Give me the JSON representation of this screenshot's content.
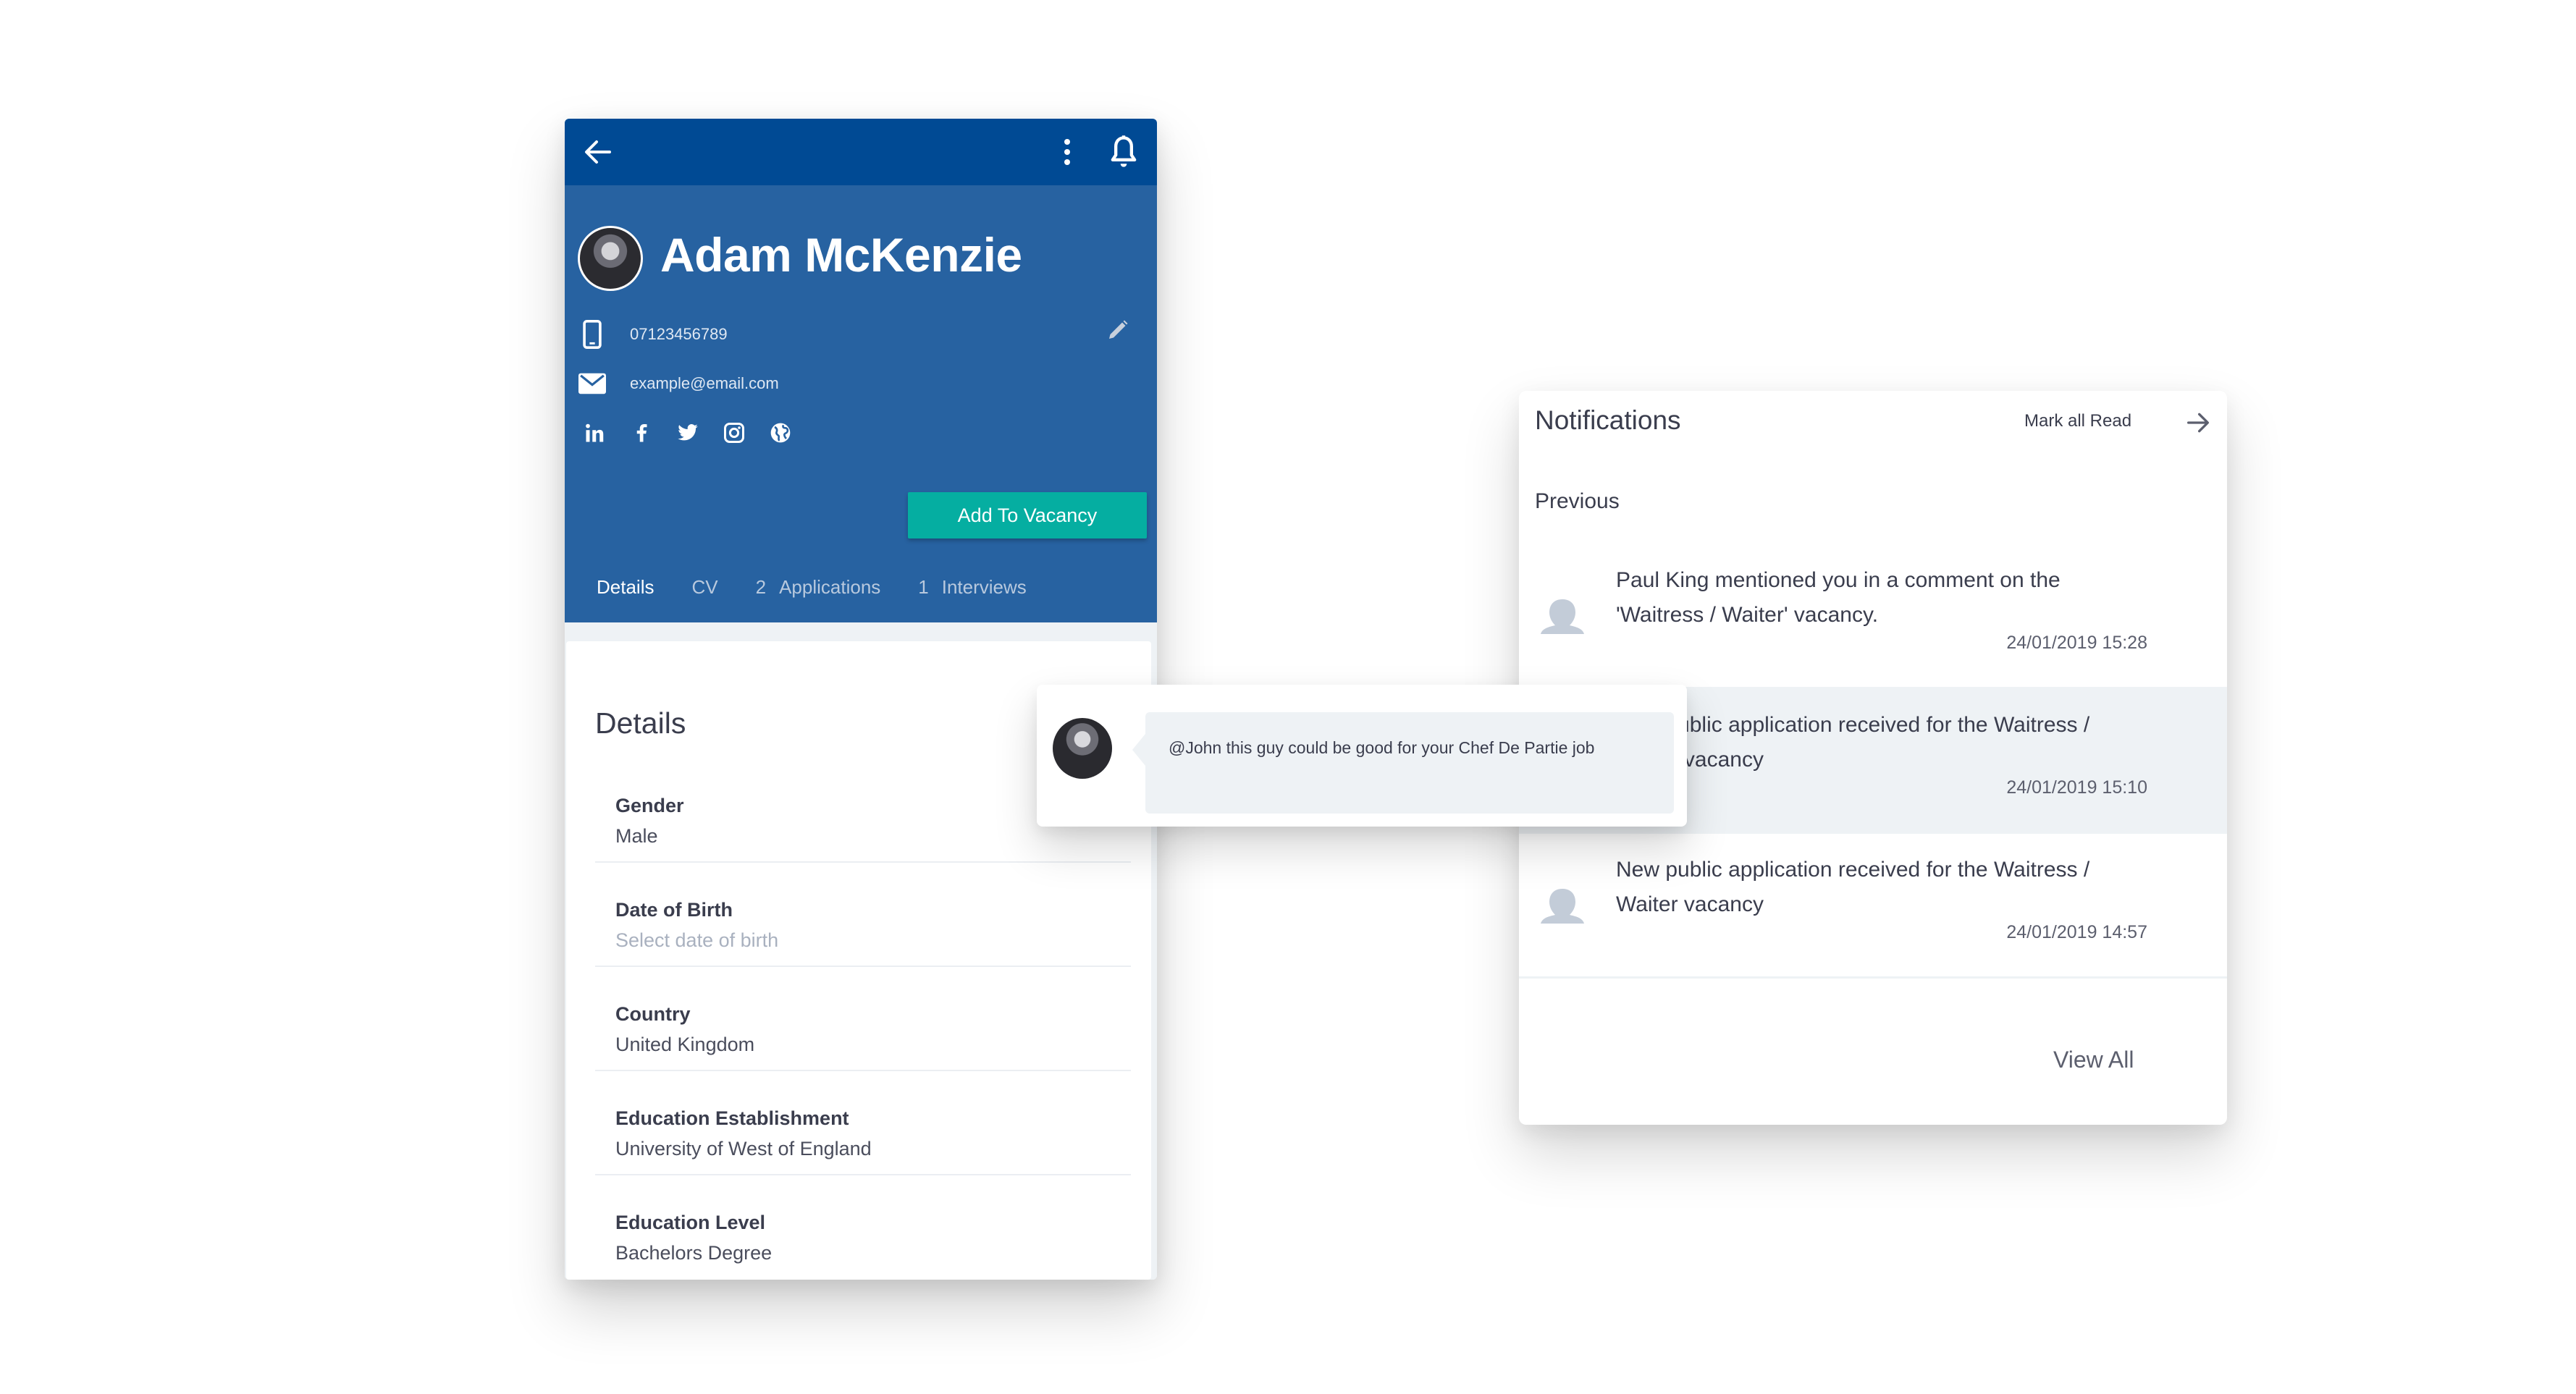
{
  "profile": {
    "name": "Adam McKenzie",
    "phone": "07123456789",
    "email": "example@email.com",
    "add_button": "Add To Vacancy",
    "icons": {
      "back": "arrow-left-icon",
      "more": "more-vertical-icon",
      "notifications": "bell-icon",
      "phone": "mobile-phone-icon",
      "email": "envelope-icon",
      "edit": "pencil-icon",
      "socials": [
        "linkedin-icon",
        "facebook-icon",
        "twitter-icon",
        "instagram-icon",
        "globe-icon"
      ]
    },
    "tabs": [
      {
        "count": "",
        "label": "Details",
        "active": true
      },
      {
        "count": "",
        "label": "CV",
        "active": false
      },
      {
        "count": "2",
        "label": "Applications",
        "active": false
      },
      {
        "count": "1",
        "label": "Interviews",
        "active": false
      }
    ],
    "details": {
      "title": "Details",
      "fields": [
        {
          "label": "Gender",
          "value": "Male"
        },
        {
          "label": "Date of Birth",
          "value": "Select date of birth",
          "placeholder": true
        },
        {
          "label": "Country",
          "value": "United Kingdom"
        },
        {
          "label": "Education Establishment",
          "value": "University of West of England"
        },
        {
          "label": "Education Level",
          "value": "Bachelors Degree"
        }
      ]
    }
  },
  "comment": {
    "message": "@John this guy could be good for your Chef De Partie job"
  },
  "notifications": {
    "title": "Notifications",
    "mark_all_read": "Mark all Read",
    "section": "Previous",
    "items": [
      {
        "text": "Paul King mentioned you in a comment on the 'Waitress / Waiter' vacancy.",
        "time": "24/01/2019 15:28",
        "highlighted": false
      },
      {
        "text": "New public application received for the Waitress / Waiter vacancy",
        "time": "24/01/2019 15:10",
        "highlighted": true
      },
      {
        "text": "New public application received for the Waitress / Waiter vacancy",
        "time": "24/01/2019 14:57",
        "highlighted": false
      }
    ],
    "view_all": "View All"
  },
  "colors": {
    "appbar": "#004a94",
    "hero": "#2762a1",
    "accent_button": "#05aea1",
    "highlight_row": "#eef2f5"
  }
}
